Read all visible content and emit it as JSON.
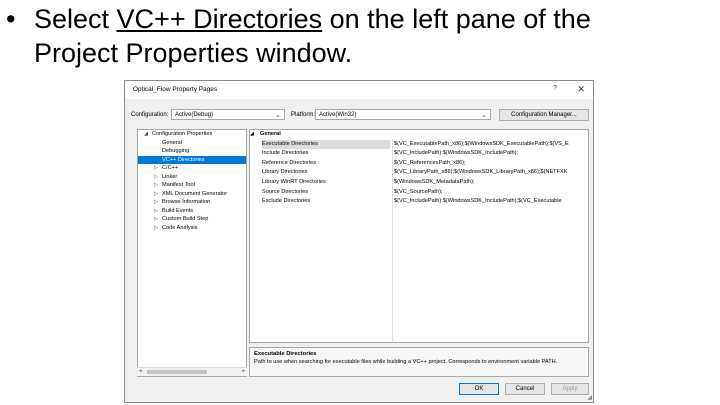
{
  "slide": {
    "bullet": "•",
    "text_before": "Select ",
    "link_text": "VC++ Directories",
    "text_after": " on the left pane of the",
    "line2": "Project Properties window."
  },
  "window": {
    "title": "Optical_Flow Property Pages",
    "help": "?",
    "close": "✕"
  },
  "toolbar": {
    "configuration_label": "Configuration:",
    "configuration_value": "Active(Debug)",
    "platform_label": "Platform:",
    "platform_value": "Active(Win32)",
    "config_manager_button": "Configuration Manager..."
  },
  "tree": {
    "items": [
      {
        "label": "Configuration Properties",
        "twisty": "◢",
        "level": 0
      },
      {
        "label": "General",
        "twisty": "",
        "level": 1
      },
      {
        "label": "Debugging",
        "twisty": "",
        "level": 1
      },
      {
        "label": "VC++ Directories",
        "twisty": "",
        "level": 1,
        "selected": true
      },
      {
        "label": "C/C++",
        "twisty": "▷",
        "level": 1
      },
      {
        "label": "Linker",
        "twisty": "▷",
        "level": 1
      },
      {
        "label": "Manifest Tool",
        "twisty": "▷",
        "level": 1
      },
      {
        "label": "XML Document Generator",
        "twisty": "▷",
        "level": 1
      },
      {
        "label": "Browse Information",
        "twisty": "▷",
        "level": 1
      },
      {
        "label": "Build Events",
        "twisty": "▷",
        "level": 1
      },
      {
        "label": "Custom Build Step",
        "twisty": "▷",
        "level": 1
      },
      {
        "label": "Code Analysis",
        "twisty": "▷",
        "level": 1
      }
    ]
  },
  "grid": {
    "category": "General",
    "category_twisty": "◢",
    "rows": [
      {
        "name": "Executable Directories",
        "value": "$(VC_ExecutablePath_x86);$(WindowsSDK_ExecutablePath);$(VS_E"
      },
      {
        "name": "Include Directories",
        "value": "$(VC_IncludePath);$(WindowsSDK_IncludePath);"
      },
      {
        "name": "Reference Directories",
        "value": "$(VC_ReferencesPath_x86);"
      },
      {
        "name": "Library Directories",
        "value": "$(VC_LibraryPath_x86);$(WindowsSDK_LibraryPath_x86);$(NETFXK"
      },
      {
        "name": "Library WinRT Directories",
        "value": "$(WindowsSDK_MetadataPath);"
      },
      {
        "name": "Source Directories",
        "value": "$(VC_SourcePath);"
      },
      {
        "name": "Exclude Directories",
        "value": "$(VC_IncludePath);$(WindowsSDK_IncludePath);$(VC_Executable"
      }
    ]
  },
  "description": {
    "title": "Executable Directories",
    "text": "Path to use when searching for executable files while building a VC++ project. Corresponds to environment variable PATH."
  },
  "buttons": {
    "ok": "OK",
    "cancel": "Cancel",
    "apply": "Apply"
  },
  "scroll": {
    "left": "◂",
    "right": "▸"
  }
}
